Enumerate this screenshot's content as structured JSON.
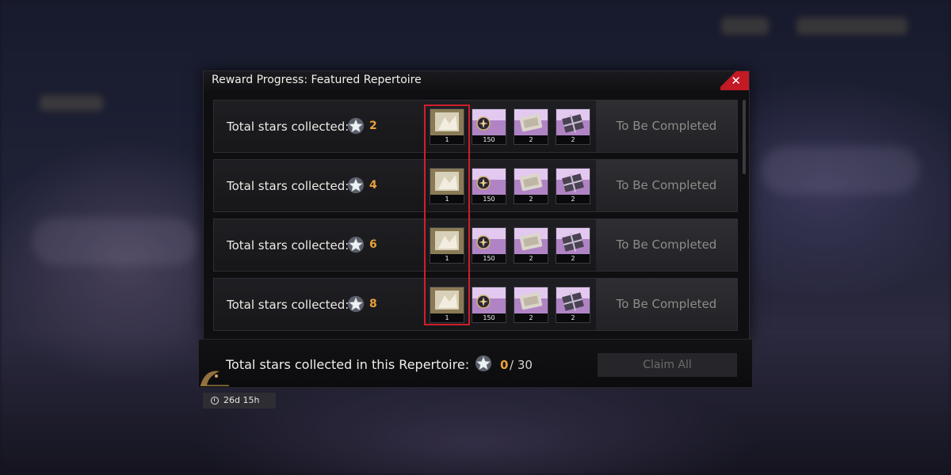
{
  "dialog": {
    "title": "Reward Progress: Featured Repertoire",
    "close_label": "✕"
  },
  "rows": [
    {
      "label": "Total stars collected:",
      "stars": "2",
      "rewards": [
        {
          "icon": "costume-card-icon",
          "qty": "1"
        },
        {
          "icon": "currency-token-icon",
          "qty": "150"
        },
        {
          "icon": "ticket-icon",
          "qty": "2"
        },
        {
          "icon": "gift-box-icon",
          "qty": "2"
        }
      ],
      "status": "To Be Completed"
    },
    {
      "label": "Total stars collected:",
      "stars": "4",
      "rewards": [
        {
          "icon": "costume-card-icon",
          "qty": "1"
        },
        {
          "icon": "currency-token-icon",
          "qty": "150"
        },
        {
          "icon": "ticket-icon",
          "qty": "2"
        },
        {
          "icon": "gift-box-icon",
          "qty": "2"
        }
      ],
      "status": "To Be Completed"
    },
    {
      "label": "Total stars collected:",
      "stars": "6",
      "rewards": [
        {
          "icon": "costume-card-icon",
          "qty": "1"
        },
        {
          "icon": "currency-token-icon",
          "qty": "150"
        },
        {
          "icon": "ticket-icon",
          "qty": "2"
        },
        {
          "icon": "gift-box-icon",
          "qty": "2"
        }
      ],
      "status": "To Be Completed"
    },
    {
      "label": "Total stars collected:",
      "stars": "8",
      "rewards": [
        {
          "icon": "costume-card-icon",
          "qty": "1"
        },
        {
          "icon": "currency-token-icon",
          "qty": "150"
        },
        {
          "icon": "ticket-icon",
          "qty": "2"
        },
        {
          "icon": "gift-box-icon",
          "qty": "2"
        }
      ],
      "status": "To Be Completed"
    }
  ],
  "footer": {
    "label": "Total stars collected in this Repertoire:",
    "current": "0",
    "total": "/ 30",
    "claim_label": "Claim All"
  },
  "timer": {
    "text": "26d 15h"
  },
  "colors": {
    "accent_orange": "#e8a13a",
    "highlight_red": "#d21e2b",
    "close_red": "#c41a25"
  }
}
